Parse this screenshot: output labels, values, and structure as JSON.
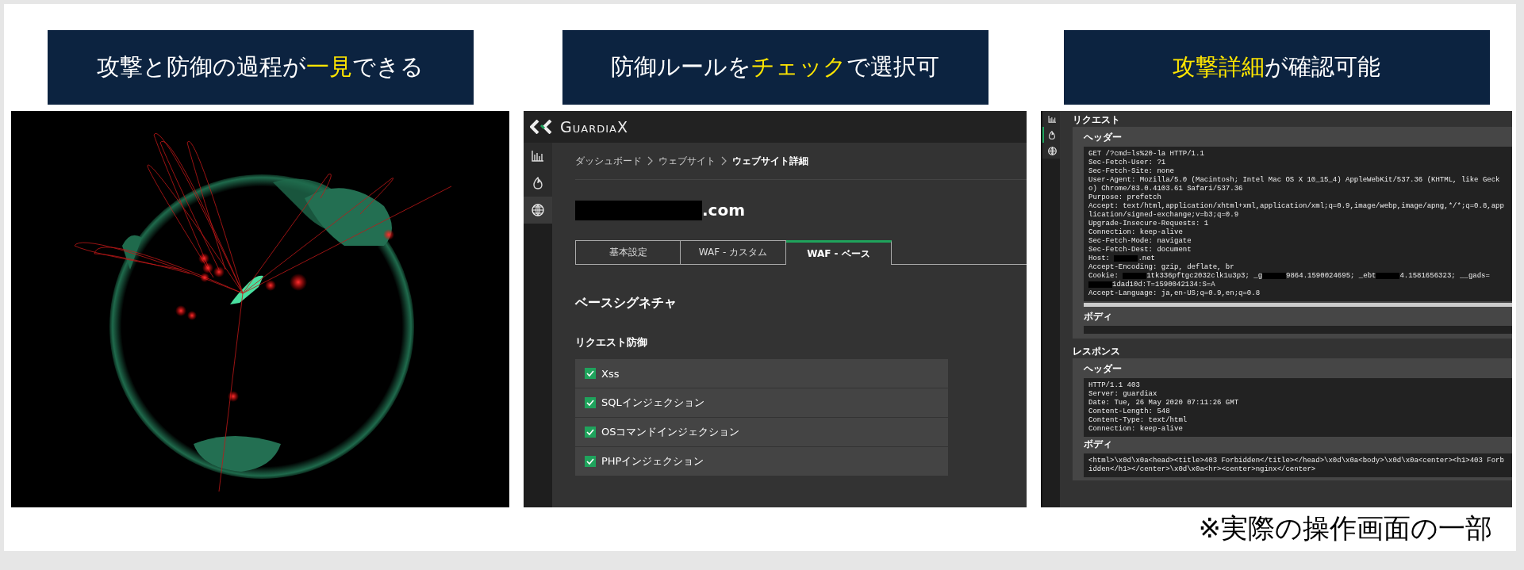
{
  "feature_headers": [
    {
      "parts": [
        {
          "text": "攻撃と防御の過程が",
          "highlight": false
        },
        {
          "text": "一見",
          "highlight": true
        },
        {
          "text": "できる",
          "highlight": false
        }
      ]
    },
    {
      "parts": [
        {
          "text": "防御ルールを",
          "highlight": false
        },
        {
          "text": "チェック",
          "highlight": true
        },
        {
          "text": "で選択可",
          "highlight": false
        }
      ]
    },
    {
      "parts": [
        {
          "text": "攻撃詳細",
          "highlight": true
        },
        {
          "text": "が確認可能",
          "highlight": false
        }
      ]
    }
  ],
  "waf_screen": {
    "logo": "GuardiaX",
    "sidebar": [
      {
        "kind": "chart",
        "selected": false
      },
      {
        "kind": "flame",
        "selected": false
      },
      {
        "kind": "globe",
        "selected": true
      }
    ],
    "breadcrumb": [
      {
        "label": "ダッシュボード",
        "current": false
      },
      {
        "label": "ウェブサイト",
        "current": false
      },
      {
        "label": "ウェブサイト詳細",
        "current": true
      }
    ],
    "domain": ".com",
    "tabs": [
      {
        "label": "基本設定",
        "selected": false
      },
      {
        "label": "WAF - カスタム",
        "selected": false
      },
      {
        "label": "WAF - ベース",
        "selected": true
      }
    ],
    "section_title": "ベースシグネチャ",
    "group_title": "リクエスト防御",
    "rules": [
      {
        "label": "Xss",
        "checked": true
      },
      {
        "label": "SQLインジェクション",
        "checked": true
      },
      {
        "label": "OSコマンドインジェクション",
        "checked": true
      },
      {
        "label": "PHPインジェクション",
        "checked": true
      }
    ]
  },
  "attack_detail_screen": {
    "sidebar": [
      {
        "kind": "chart",
        "selected": false
      },
      {
        "kind": "flame",
        "selected": true
      },
      {
        "kind": "globe",
        "selected": false
      }
    ],
    "sections": [
      {
        "title": "リクエスト",
        "blocks": [
          {
            "title": "ヘッダー",
            "h_scrollbar": true,
            "lines": [
              [
                "GET /?cmd=ls%20-la HTTP/1.1"
              ],
              [
                "Sec-Fetch-User: ?1"
              ],
              [
                "Sec-Fetch-Site: none"
              ],
              [
                "User-Agent: Mozilla/5.0 (Macintosh; Intel Mac OS X 10_15_4) AppleWebKit/537.36 (KHTML, like Gecko) Chrome/83.0.4103.61 Safari/537.36"
              ],
              [
                "Purpose: prefetch"
              ],
              [
                "Accept: text/html,application/xhtml+xml,application/xml;q=0.9,image/webp,image/apng,*/*;q=0.8,application/signed-exchange;v=b3;q=0.9"
              ],
              [
                "Upgrade-Insecure-Requests: 1"
              ],
              [
                "Connection: keep-alive"
              ],
              [
                "Sec-Fetch-Mode: navigate"
              ],
              [
                "Sec-Fetch-Dest: document"
              ],
              [
                "Host: ",
                ".net"
              ],
              [
                "Accept-Encoding: gzip, deflate, br"
              ],
              [
                "Cookie: ",
                "1tk336pftgc2032clk1u3p3; _g",
                "9864.1590024695; _ebt",
                "4.1581656323; __gads=",
                "1dad10d:T=1590042134:S=A"
              ],
              [
                "Accept-Language: ja,en-US;q=0.9,en;q=0.8"
              ]
            ]
          },
          {
            "title": "ボディ"
          }
        ]
      },
      {
        "title": "レスポンス",
        "blocks": [
          {
            "title": "ヘッダー",
            "lines": [
              [
                "HTTP/1.1 403"
              ],
              [
                "Server: guardiax"
              ],
              [
                "Date: Tue, 26 May 2020 07:11:26 GMT"
              ],
              [
                "Content-Length: 548"
              ],
              [
                "Content-Type: text/html"
              ],
              [
                "Connection: keep-alive"
              ]
            ]
          },
          {
            "title": "ボディ",
            "lines": [
              [
                "<html>\\x0d\\x0a<head><title>403 Forbidden</title></head>\\x0d\\x0a<body>\\x0d\\x0a<center><h1>403 Forbidden</h1></center>\\x0d\\x0a<hr><center>nginx</center>"
              ]
            ]
          }
        ]
      }
    ]
  },
  "footnote": "※実際の操作画面の一部"
}
